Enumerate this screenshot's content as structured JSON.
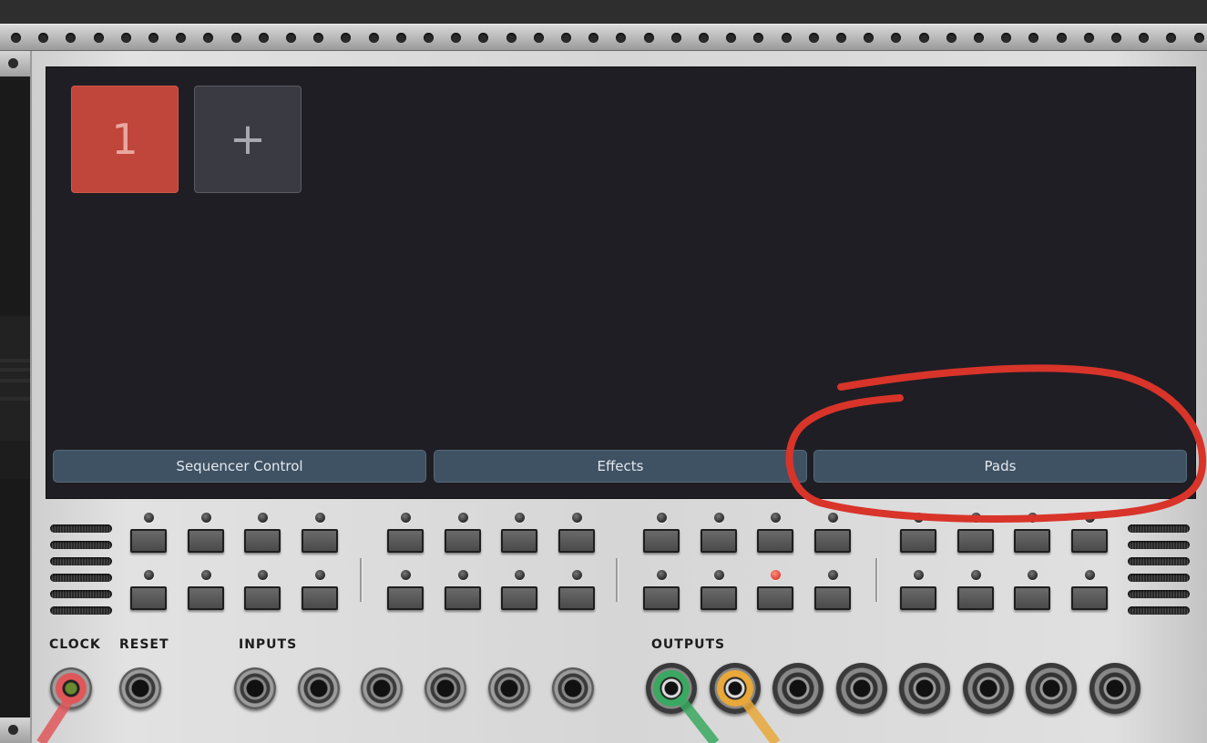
{
  "display": {
    "sequences": [
      {
        "label": "1",
        "active": true
      },
      {
        "label": "+",
        "active": false
      }
    ],
    "tabs": [
      {
        "label": "Sequencer Control"
      },
      {
        "label": "Effects"
      },
      {
        "label": "Pads"
      }
    ]
  },
  "panel": {
    "clock_label": "CLOCK",
    "reset_label": "RESET",
    "inputs_label": "INPUTS",
    "outputs_label": "OUTPUTS",
    "input_count": 6,
    "output_count": 8,
    "lit_led": {
      "row": 2,
      "index": 10
    }
  },
  "colors": {
    "active_sequence": "#c0453a",
    "tab_bg": "#3f5263",
    "annotation": "#d8342a",
    "cable_clock": "#e0575a",
    "cable_out1": "#3aa860",
    "cable_out2": "#e8a83a"
  }
}
